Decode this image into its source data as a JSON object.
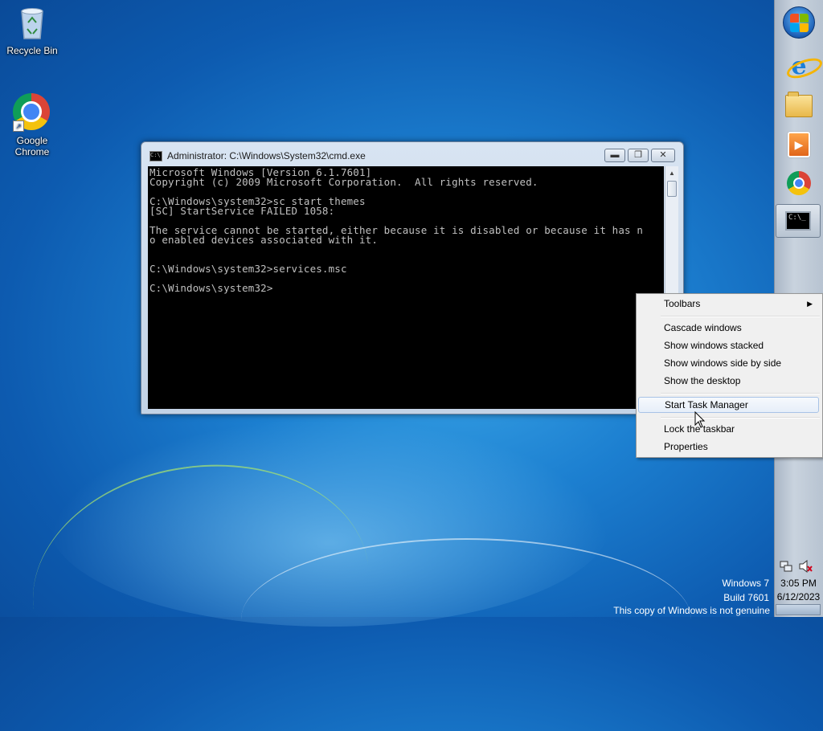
{
  "desktop": {
    "icons": [
      {
        "label": "Recycle Bin",
        "icon": "recycle-bin-icon"
      },
      {
        "label": "Google Chrome",
        "label_line1": "Google",
        "label_line2": "Chrome",
        "icon": "chrome-icon"
      }
    ],
    "watermark": {
      "line1": "Windows 7",
      "line2": "Build 7601",
      "line3": "This copy of Windows is not genuine"
    }
  },
  "cmd_window": {
    "title": "Administrator: C:\\Windows\\System32\\cmd.exe",
    "console_lines": [
      "Microsoft Windows [Version 6.1.7601]",
      "Copyright (c) 2009 Microsoft Corporation.  All rights reserved.",
      "",
      "C:\\Windows\\system32>sc start themes",
      "[SC] StartService FAILED 1058:",
      "",
      "The service cannot be started, either because it is disabled or because it has n",
      "o enabled devices associated with it.",
      "",
      "",
      "C:\\Windows\\system32>services.msc",
      "",
      "C:\\Windows\\system32>"
    ],
    "buttons": {
      "minimize": "minimize-icon",
      "maximize": "restore-icon",
      "close": "close-icon"
    }
  },
  "taskbar": {
    "pinned": [
      {
        "name": "start-orb-icon"
      },
      {
        "name": "internet-explorer-icon"
      },
      {
        "name": "file-explorer-icon"
      },
      {
        "name": "media-player-icon"
      },
      {
        "name": "chrome-icon"
      },
      {
        "name": "cmd-icon",
        "active": true
      }
    ],
    "tray": {
      "network": "network-icon",
      "volume": "volume-muted-icon"
    },
    "clock": {
      "time": "3:05 PM",
      "date": "6/12/2023"
    }
  },
  "context_menu": {
    "items": [
      {
        "label": "Toolbars",
        "submenu": true
      },
      {
        "label": "Cascade windows"
      },
      {
        "label": "Show windows stacked"
      },
      {
        "label": "Show windows side by side"
      },
      {
        "label": "Show the desktop"
      },
      {
        "label": "Start Task Manager",
        "hovered": true
      },
      {
        "label": "Lock the taskbar"
      },
      {
        "label": "Properties"
      }
    ]
  }
}
